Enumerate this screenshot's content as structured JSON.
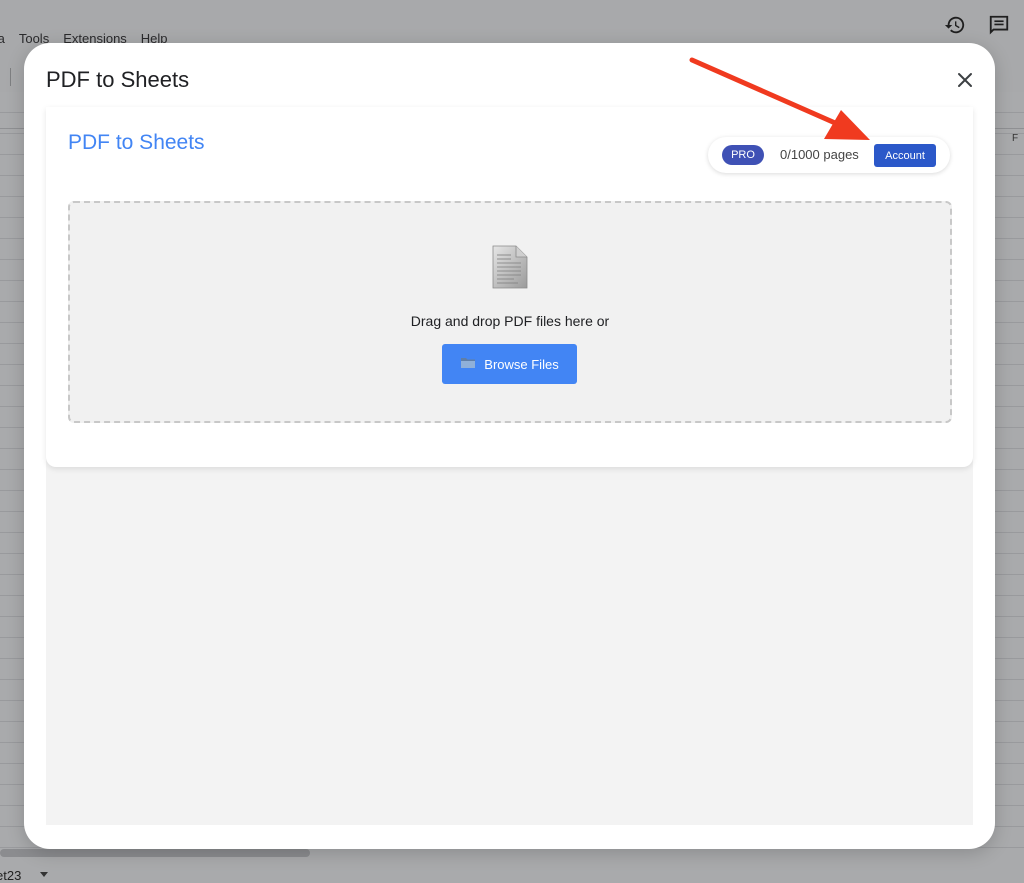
{
  "background": {
    "menu": [
      "ta",
      "Tools",
      "Extensions",
      "Help"
    ],
    "column_label": "F",
    "sheet_tab": "et23",
    "icons": [
      "history-icon",
      "comment-icon"
    ]
  },
  "dialog": {
    "title": "PDF to Sheets",
    "close_icon": "close-icon"
  },
  "app": {
    "title": "PDF to Sheets",
    "plan_badge": "PRO",
    "usage": "0/1000 pages",
    "account_label": "Account",
    "drop_text": "Drag and drop PDF files here or",
    "browse_label": "Browse Files",
    "document_icon": "document-icon",
    "folder_icon": "folder-icon"
  },
  "annotation": {
    "arrow_color": "#f03a1f"
  },
  "colors": {
    "accent": "#4285f4",
    "account_button": "#2b58c9",
    "pro_badge": "#3f51b5"
  }
}
